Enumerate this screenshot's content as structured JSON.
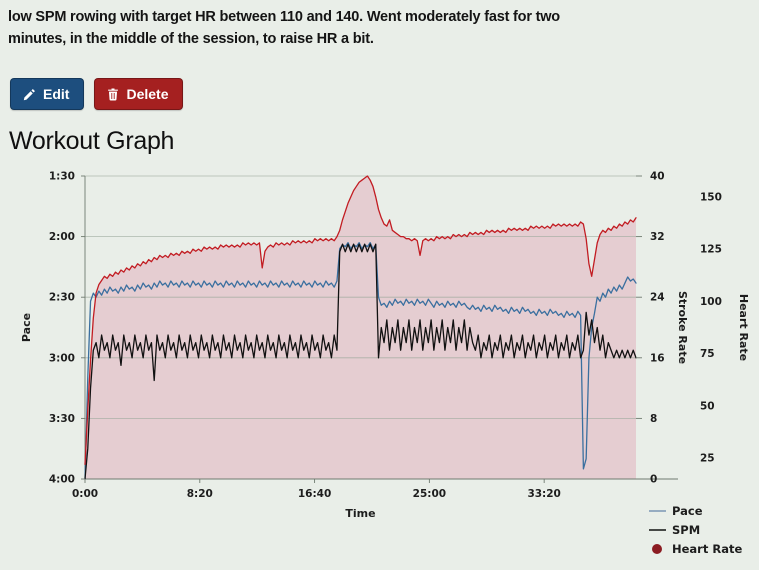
{
  "description": "low SPM rowing with target HR between 110 and 140. Went moderately fast for two minutes, in the middle of the session, to raise HR a bit.",
  "buttons": {
    "edit_label": "Edit",
    "edit_icon": "pencil-icon",
    "edit_color": "#1d4e7e",
    "delete_label": "Delete",
    "delete_icon": "trash-icon",
    "delete_color": "#a52020"
  },
  "page_title": "Workout Graph",
  "colors": {
    "background": "#e9eee8",
    "plot_fill": "#e5cdd1",
    "pace_line": "#3a6f9f",
    "spm_line": "#111111",
    "hr_line": "#c21c22",
    "gridline": "#9aa79a",
    "text": "#1d1d1d"
  },
  "chart_data": {
    "type": "line",
    "title": "Workout Graph",
    "xlabel": "Time",
    "grid": true,
    "legend_position": "right-bottom",
    "x_axis": {
      "label": "Time",
      "ticks": [
        "0:00",
        "8:20",
        "16:40",
        "25:00",
        "33:20"
      ],
      "tick_values": [
        0,
        500,
        1000,
        1500,
        2000
      ],
      "xlim": [
        0,
        2400
      ]
    },
    "y_axes": [
      {
        "name": "Pace",
        "label": "Pace",
        "side": "left",
        "ticks": [
          "1:30",
          "2:00",
          "2:30",
          "3:00",
          "3:30",
          "4:00"
        ],
        "tick_values": [
          90,
          120,
          150,
          180,
          210,
          240
        ],
        "ylim": [
          90,
          240
        ],
        "inverted": true
      },
      {
        "name": "Stroke Rate",
        "label": "Stroke Rate",
        "side": "right",
        "ticks": [
          "40",
          "32",
          "24",
          "16",
          "8",
          "0"
        ],
        "tick_values": [
          40,
          32,
          24,
          16,
          8,
          0
        ],
        "ylim": [
          0,
          40
        ]
      },
      {
        "name": "Heart Rate",
        "label": "Heart Rate",
        "side": "right",
        "ticks": [
          "150",
          "125",
          "100",
          "75",
          "50",
          "25"
        ],
        "tick_values": [
          150,
          125,
          100,
          75,
          50,
          25
        ],
        "ylim": [
          15,
          160
        ]
      }
    ],
    "legend": [
      {
        "name": "Pace",
        "marker": "line",
        "color": "#7a96b4"
      },
      {
        "name": "SPM",
        "marker": "line",
        "color": "#111111"
      },
      {
        "name": "Heart Rate",
        "marker": "circle",
        "color": "#8b1c22"
      }
    ],
    "series": [
      {
        "name": "Pace",
        "axis": "Pace",
        "color": "#3a6f9f",
        "unit": "min/500m",
        "values": [
          240,
          190,
          152,
          148,
          150,
          147,
          149,
          146,
          148,
          145,
          147,
          146,
          148,
          145,
          147,
          144,
          146,
          145,
          147,
          144,
          146,
          143,
          145,
          144,
          146,
          143,
          145,
          142,
          144,
          143,
          145,
          142,
          144,
          143,
          145,
          142,
          144,
          143,
          145,
          142,
          144,
          143,
          145,
          142,
          144,
          143,
          145,
          142,
          144,
          143,
          145,
          142,
          144,
          143,
          145,
          142,
          144,
          143,
          145,
          142,
          144,
          143,
          145,
          142,
          144,
          143,
          145,
          142,
          144,
          143,
          145,
          142,
          144,
          143,
          145,
          142,
          144,
          143,
          145,
          142,
          144,
          143,
          145,
          142,
          144,
          143,
          145,
          142,
          144,
          143,
          145,
          142,
          126,
          124,
          125,
          123,
          126,
          124,
          125,
          123,
          126,
          124,
          125,
          123,
          126,
          124,
          150,
          154,
          153,
          155,
          152,
          154,
          151,
          153,
          152,
          154,
          151,
          153,
          152,
          154,
          151,
          153,
          152,
          154,
          151,
          153,
          155,
          152,
          154,
          153,
          155,
          152,
          154,
          153,
          155,
          152,
          154,
          153,
          155,
          156,
          154,
          156,
          155,
          157,
          154,
          156,
          155,
          157,
          154,
          156,
          155,
          157,
          156,
          158,
          155,
          157,
          156,
          158,
          155,
          157,
          156,
          158,
          157,
          159,
          156,
          158,
          157,
          159,
          156,
          158,
          157,
          159,
          158,
          160,
          157,
          159,
          158,
          160,
          157,
          159,
          235,
          230,
          180,
          165,
          158,
          150,
          152,
          148,
          150,
          146,
          148,
          145,
          147,
          144,
          146,
          143,
          140,
          142,
          141,
          143
        ]
      },
      {
        "name": "SPM",
        "axis": "Stroke Rate",
        "color": "#111111",
        "unit": "strokes/min",
        "values": [
          0,
          4,
          12,
          17,
          18,
          16,
          19,
          17,
          18,
          16,
          19,
          17,
          18,
          15,
          19,
          17,
          18,
          16,
          19,
          17,
          18,
          16,
          19,
          17,
          18,
          13,
          19,
          17,
          18,
          16,
          19,
          17,
          18,
          16,
          19,
          17,
          18,
          16,
          19,
          17,
          18,
          16,
          19,
          17,
          18,
          16,
          19,
          17,
          18,
          16,
          19,
          17,
          18,
          16,
          19,
          17,
          18,
          16,
          19,
          17,
          18,
          16,
          19,
          17,
          18,
          16,
          19,
          17,
          18,
          16,
          19,
          17,
          18,
          16,
          19,
          17,
          18,
          16,
          19,
          17,
          18,
          16,
          19,
          17,
          18,
          16,
          19,
          17,
          18,
          16,
          19,
          17,
          30,
          31,
          30,
          31,
          30,
          31,
          30,
          31,
          30,
          31,
          30,
          31,
          30,
          31,
          16,
          20,
          18,
          21,
          17,
          20,
          18,
          21,
          17,
          20,
          18,
          21,
          17,
          20,
          18,
          21,
          17,
          20,
          18,
          21,
          17,
          20,
          18,
          21,
          17,
          20,
          18,
          21,
          17,
          20,
          18,
          21,
          17,
          20,
          18,
          17,
          19,
          16,
          18,
          17,
          19,
          16,
          18,
          17,
          19,
          16,
          18,
          17,
          19,
          16,
          18,
          17,
          19,
          16,
          18,
          17,
          19,
          16,
          18,
          17,
          19,
          16,
          18,
          17,
          19,
          16,
          18,
          17,
          19,
          16,
          18,
          17,
          19,
          16,
          17,
          22,
          19,
          21,
          18,
          20,
          17,
          19,
          16,
          18,
          17,
          16,
          17,
          16,
          17,
          16,
          17,
          16,
          17,
          16
        ]
      },
      {
        "name": "Heart Rate",
        "axis": "Heart Rate",
        "color": "#c21c22",
        "unit": "bpm",
        "values": [
          22,
          48,
          72,
          92,
          104,
          108,
          110,
          112,
          111,
          113,
          112,
          114,
          113,
          115,
          114,
          116,
          115,
          117,
          116,
          118,
          117,
          119,
          118,
          120,
          119,
          121,
          120,
          122,
          121,
          122,
          121,
          123,
          122,
          123,
          122,
          124,
          123,
          124,
          123,
          125,
          124,
          125,
          124,
          126,
          125,
          126,
          125,
          126,
          125,
          127,
          126,
          127,
          126,
          127,
          126,
          127,
          126,
          128,
          127,
          128,
          127,
          128,
          127,
          128,
          116,
          124,
          126,
          127,
          126,
          128,
          127,
          128,
          127,
          128,
          127,
          129,
          128,
          129,
          128,
          129,
          128,
          129,
          128,
          130,
          129,
          130,
          129,
          130,
          129,
          130,
          129,
          131,
          134,
          139,
          143,
          147,
          150,
          153,
          155,
          157,
          158,
          159,
          160,
          158,
          155,
          150,
          144,
          140,
          137,
          136,
          139,
          134,
          133,
          132,
          131,
          131,
          130,
          130,
          129,
          130,
          129,
          122,
          129,
          130,
          129,
          130,
          129,
          131,
          130,
          131,
          130,
          131,
          130,
          132,
          131,
          132,
          131,
          132,
          131,
          133,
          132,
          133,
          132,
          133,
          132,
          134,
          133,
          134,
          133,
          134,
          133,
          134,
          133,
          135,
          134,
          135,
          134,
          135,
          134,
          135,
          134,
          136,
          135,
          136,
          135,
          136,
          135,
          136,
          135,
          137,
          136,
          137,
          136,
          137,
          136,
          137,
          136,
          137,
          136,
          138,
          137,
          130,
          118,
          112,
          120,
          128,
          132,
          134,
          133,
          135,
          134,
          136,
          135,
          137,
          136,
          138,
          137,
          139,
          138,
          140
        ]
      }
    ]
  }
}
